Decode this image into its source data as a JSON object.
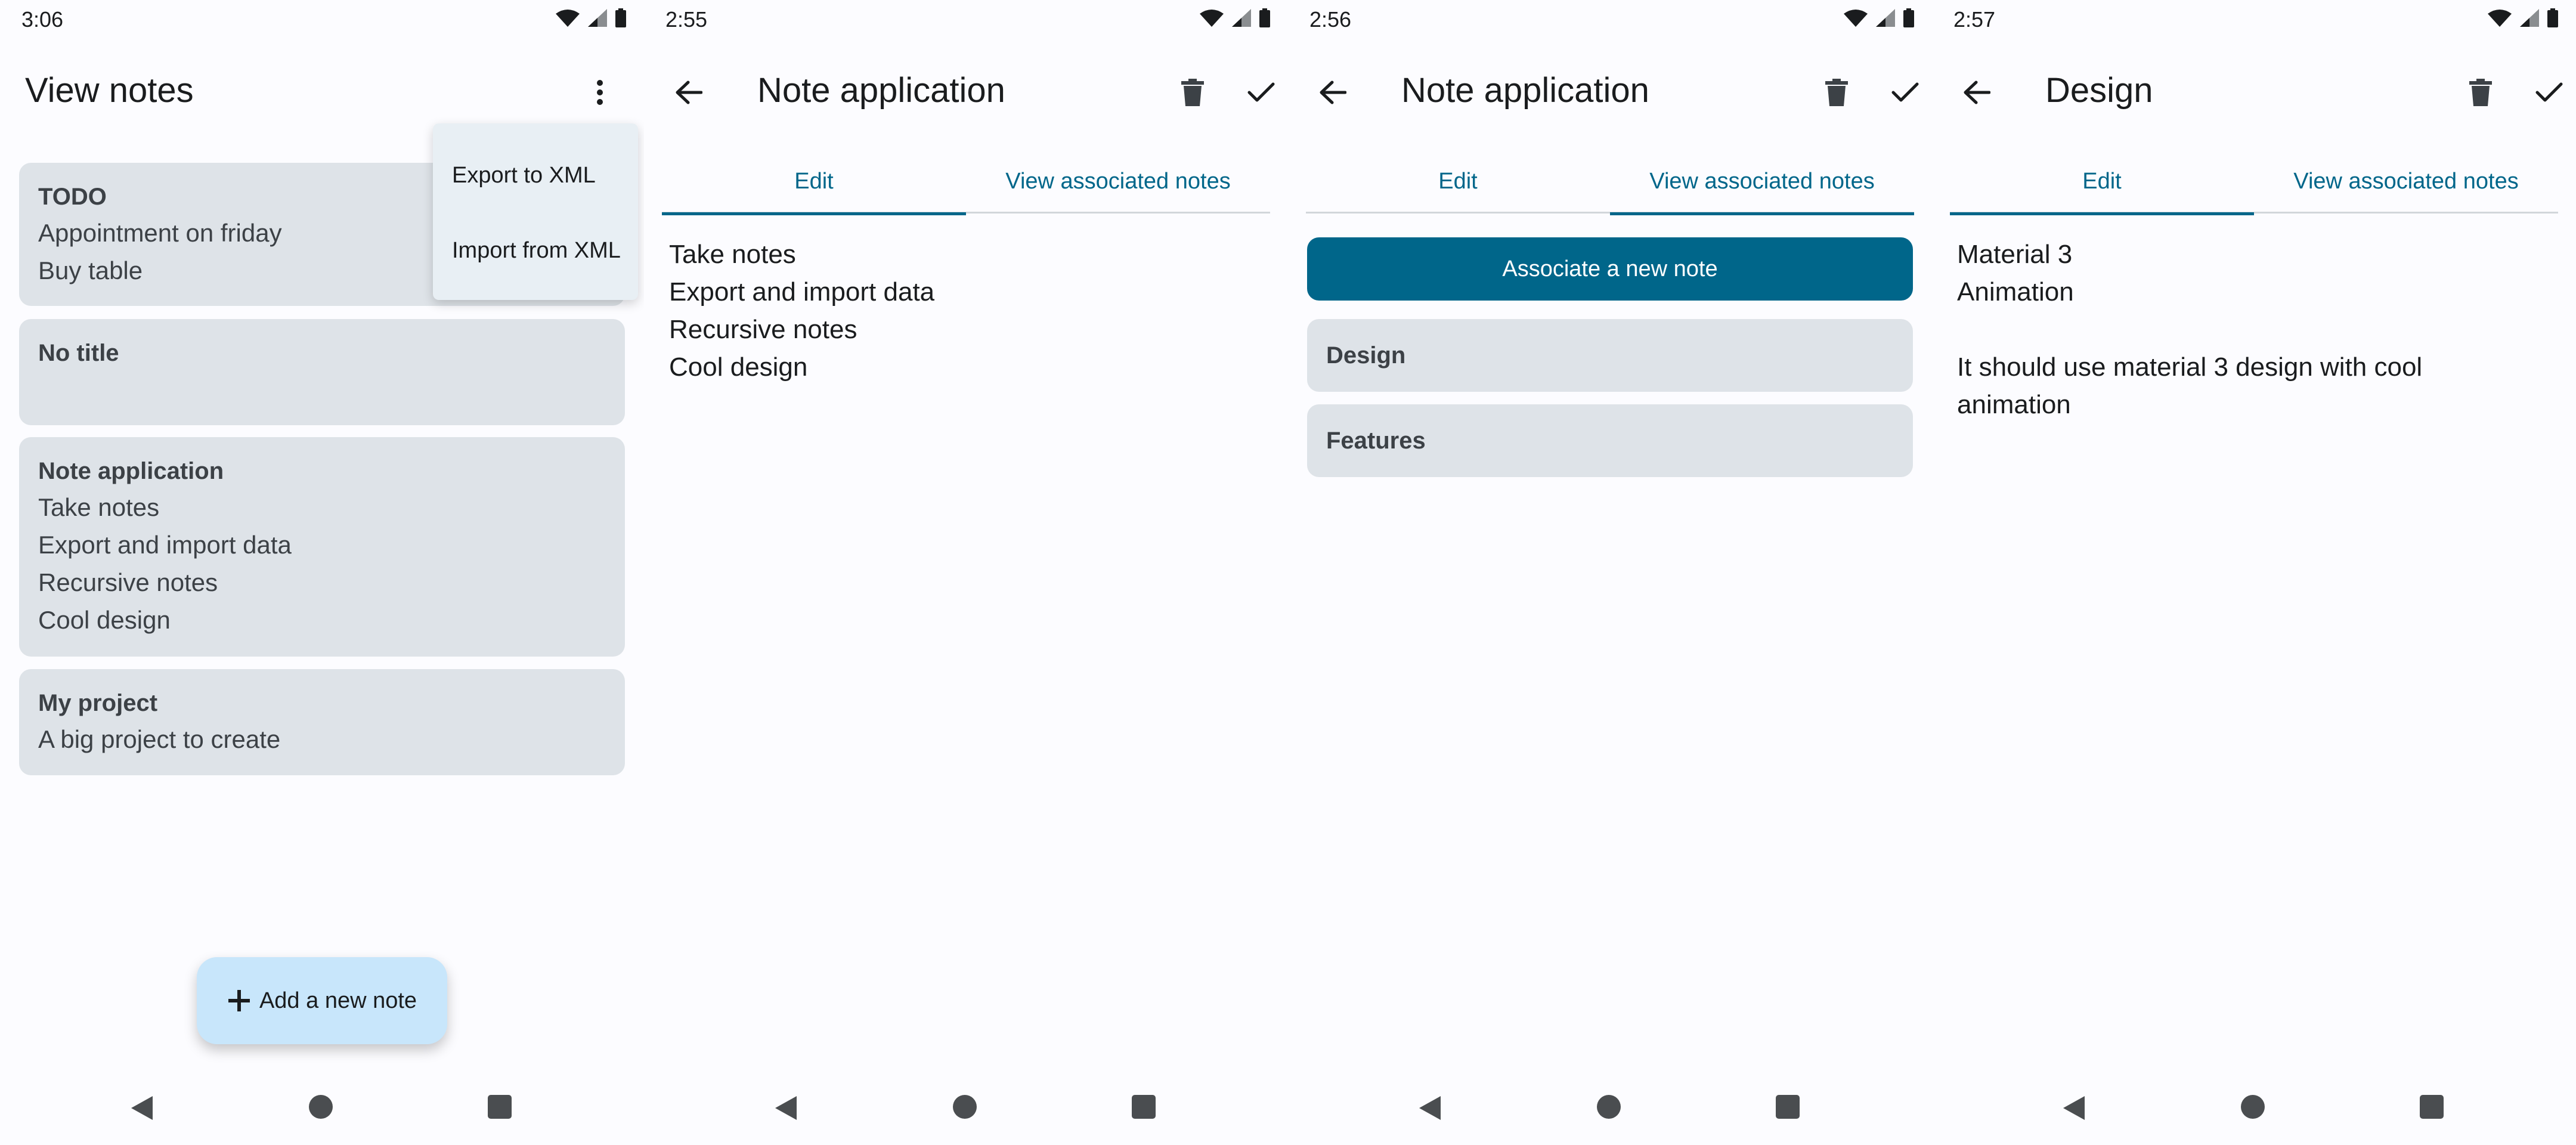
{
  "colors": {
    "primary": "#00668a",
    "card": "#dee3e8",
    "fab": "#c8e6fb",
    "menu": "#e8eff4",
    "background": "#fcfcff",
    "on_surface": "#1a1c1e"
  },
  "icons": [
    "wifi-icon",
    "signal-icon",
    "battery-icon",
    "more-vert-icon",
    "arrow-back-icon",
    "delete-icon",
    "check-icon",
    "add-icon",
    "nav-back-icon",
    "nav-home-icon",
    "nav-recent-icon"
  ],
  "screen1": {
    "status_time": "3:06",
    "title": "View notes",
    "menu": {
      "export": "Export to XML",
      "import": "Import from XML"
    },
    "notes": [
      {
        "title": "TODO",
        "lines": [
          "Appointment on friday",
          "Buy table"
        ]
      },
      {
        "title": "No title",
        "lines": []
      },
      {
        "title": "Note application",
        "lines": [
          "Take notes",
          "Export and import data",
          "Recursive notes",
          "Cool design"
        ]
      },
      {
        "title": "My project",
        "lines": [
          "A big project to create"
        ]
      }
    ],
    "fab_label": "Add a new note"
  },
  "screen2": {
    "status_time": "2:55",
    "title": "Note application",
    "tabs": {
      "edit": "Edit",
      "associated": "View associated notes"
    },
    "active_tab": "edit",
    "content": [
      "Take notes",
      "Export and import data",
      "Recursive notes",
      "Cool design"
    ]
  },
  "screen3": {
    "status_time": "2:56",
    "title": "Note application",
    "tabs": {
      "edit": "Edit",
      "associated": "View associated notes"
    },
    "active_tab": "associated",
    "associate_label": "Associate a new note",
    "associated": [
      "Design",
      "Features"
    ]
  },
  "screen4": {
    "status_time": "2:57",
    "title": "Design",
    "tabs": {
      "edit": "Edit",
      "associated": "View associated notes"
    },
    "active_tab": "edit",
    "content": [
      "Material 3",
      "Animation",
      "",
      "It should use material 3 design with cool",
      "animation"
    ]
  }
}
